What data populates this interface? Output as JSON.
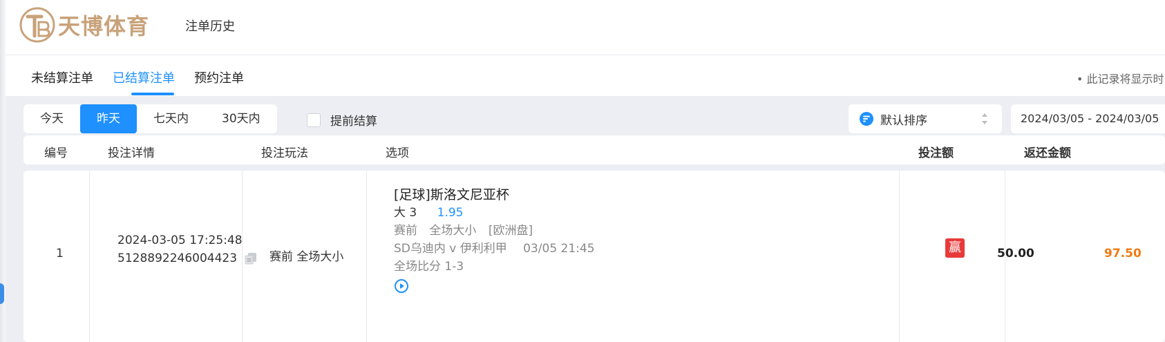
{
  "brand": {
    "name": "天博体育",
    "accent": "#c8a27a"
  },
  "header": {
    "title": "注单历史"
  },
  "tabs": [
    {
      "label": "未结算注单",
      "active": false
    },
    {
      "label": "已结算注单",
      "active": true
    },
    {
      "label": "预约注单",
      "active": false
    }
  ],
  "notice": "• 此记录将显示时",
  "filters": {
    "ranges": [
      "今天",
      "昨天",
      "七天内",
      "30天内"
    ],
    "active_range": "昨天",
    "advance_label": "提前结算",
    "advance_checked": false,
    "sort_label": "默认排序",
    "date_range": "2024/03/05 - 2024/03/05"
  },
  "table": {
    "headers": [
      "编号",
      "投注详情",
      "投注玩法",
      "选项",
      "投注额",
      "返还金额"
    ],
    "rows": [
      {
        "id": "1",
        "datetime": "2024-03-05 17:25:48",
        "bet_no": "5128892246004423",
        "play": "赛前 全场大小",
        "sel_title": "[足球]斯洛文尼亚杯",
        "sel_pick": "大 3",
        "sel_odds": "1.95",
        "meta_phase": "赛前",
        "meta_market": "全场大小",
        "meta_odds_type": "[欧洲盘]",
        "match": "SD乌迪内 v 伊利利甲",
        "match_time": "03/05 21:45",
        "score": "全场比分 1-3",
        "result": "赢",
        "stake": "50.00",
        "return": "97.50"
      }
    ]
  },
  "colors": {
    "primary": "#1e90ff",
    "win": "#e93a3a",
    "return": "#f07a14"
  },
  "icons": [
    "logo-icon",
    "sort-icon",
    "sort-arrows-icon",
    "copy-icon",
    "replay-icon"
  ]
}
